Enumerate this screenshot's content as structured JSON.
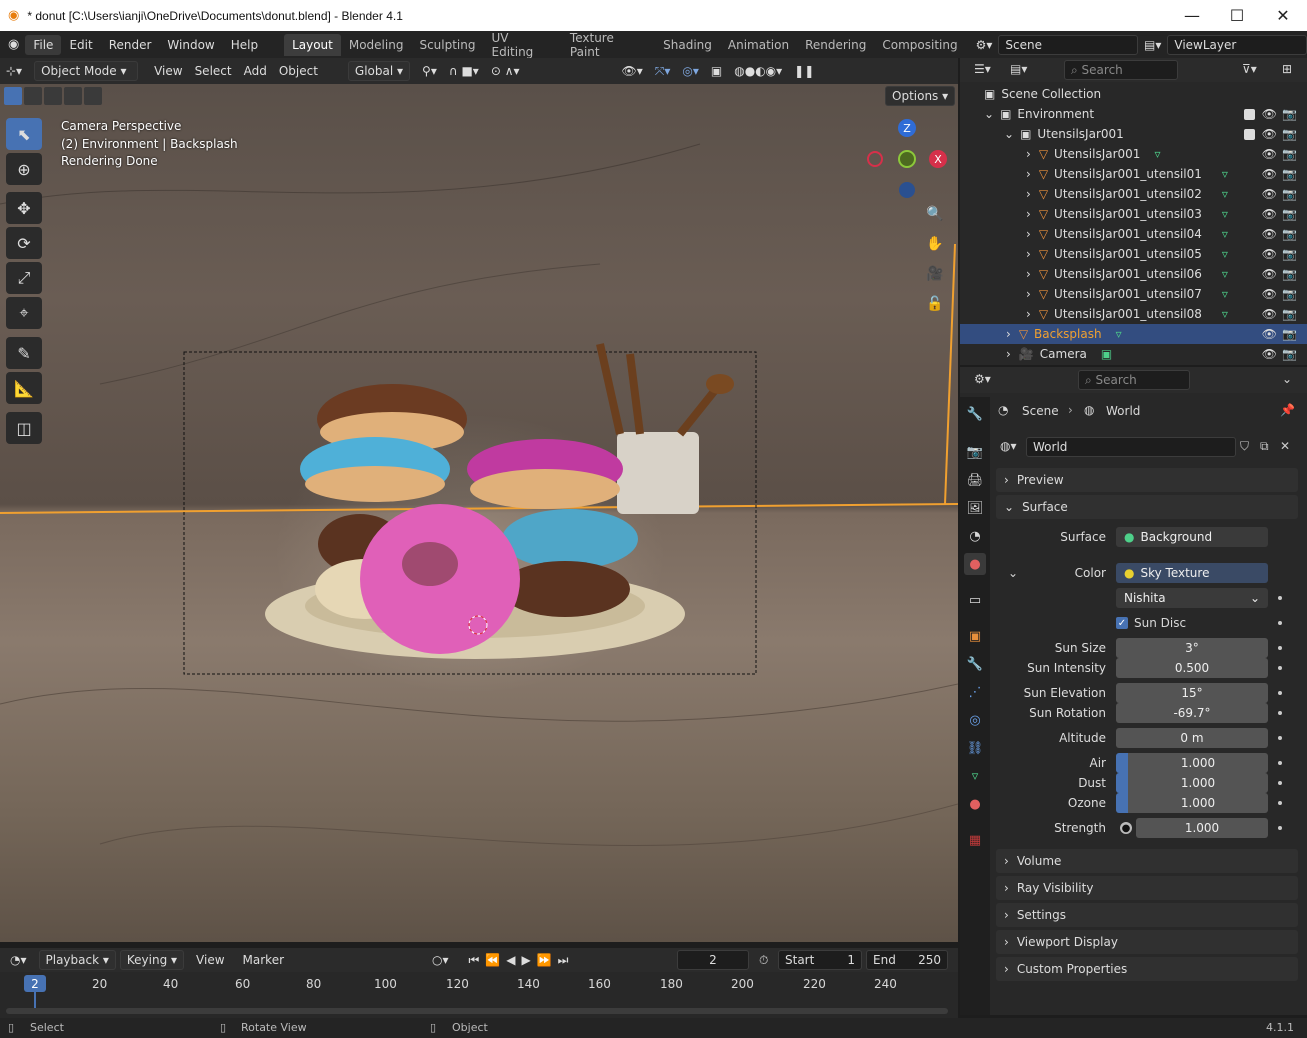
{
  "window": {
    "title": "* donut [C:\\Users\\ianji\\OneDrive\\Documents\\donut.blend] - Blender 4.1",
    "minimize": "—",
    "maximize": "☐",
    "close": "✕"
  },
  "menu": [
    "File",
    "Edit",
    "Render",
    "Window",
    "Help"
  ],
  "workspaces": [
    "Layout",
    "Modeling",
    "Sculpting",
    "UV Editing",
    "Texture Paint",
    "Shading",
    "Animation",
    "Rendering",
    "Compositing"
  ],
  "scene": "Scene",
  "view_layer": "ViewLayer",
  "viewport_header": {
    "mode": "Object Mode",
    "menus": [
      "View",
      "Select",
      "Add",
      "Object"
    ],
    "orientation": "Global",
    "options": "Options"
  },
  "viewport_overlay": {
    "line1": "Camera Perspective",
    "line2": "(2) Environment | Backsplash",
    "line3": "Rendering Done"
  },
  "gizmo": {
    "z": "Z",
    "x": "X"
  },
  "outliner": {
    "search": "Search",
    "root": "Scene Collection",
    "rows": [
      "Environment",
      "UtensilsJar001",
      "UtensilsJar001",
      "UtensilsJar001_utensil01",
      "UtensilsJar001_utensil02",
      "UtensilsJar001_utensil03",
      "UtensilsJar001_utensil04",
      "UtensilsJar001_utensil05",
      "UtensilsJar001_utensil06",
      "UtensilsJar001_utensil07",
      "UtensilsJar001_utensil08",
      "Backsplash",
      "Camera"
    ]
  },
  "properties": {
    "search": "Search",
    "breadcrumb": [
      "Scene",
      "World"
    ],
    "world_name": "World",
    "panels": {
      "preview": "Preview",
      "surface": "Surface",
      "volume": "Volume",
      "ray_visibility": "Ray Visibility",
      "settings": "Settings",
      "viewport_display": "Viewport Display",
      "custom_properties": "Custom Properties"
    },
    "surface_label": "Surface",
    "surface_value": "Background",
    "color_label": "Color",
    "color_value": "Sky Texture",
    "sky_type": "Nishita",
    "sun_disc": "Sun Disc",
    "fields": [
      {
        "label": "Sun Size",
        "value": "3°"
      },
      {
        "label": "Sun Intensity",
        "value": "0.500"
      },
      {
        "label": "Sun Elevation",
        "value": "15°"
      },
      {
        "label": "Sun Rotation",
        "value": "-69.7°"
      },
      {
        "label": "Altitude",
        "value": "0 m"
      },
      {
        "label": "Air",
        "value": "1.000"
      },
      {
        "label": "Dust",
        "value": "1.000"
      },
      {
        "label": "Ozone",
        "value": "1.000"
      },
      {
        "label": "Strength",
        "value": "1.000"
      }
    ]
  },
  "timeline": {
    "menus": [
      "Playback",
      "Keying",
      "View",
      "Marker"
    ],
    "current": "2",
    "start_label": "Start",
    "start": "1",
    "end_label": "End",
    "end": "250",
    "ticks": [
      "20",
      "40",
      "60",
      "80",
      "100",
      "120",
      "140",
      "160",
      "180",
      "200",
      "220",
      "240"
    ],
    "frame_marker": "2"
  },
  "status": {
    "select": "Select",
    "rotate": "Rotate View",
    "object": "Object",
    "version": "4.1.1"
  }
}
